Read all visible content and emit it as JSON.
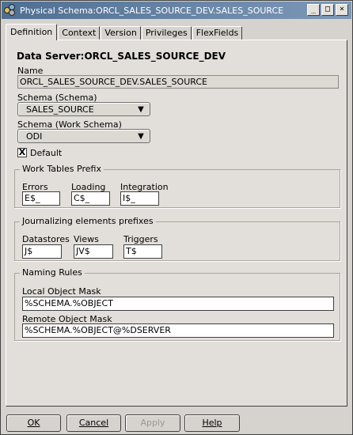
{
  "window": {
    "title": "Physical Schema:ORCL_SALES_SOURCE_DEV.SALES_SOURCE",
    "min_glyph": "_",
    "max_glyph": "□",
    "close_glyph": "×"
  },
  "tabs": [
    {
      "label": "Definition",
      "active": true
    },
    {
      "label": "Context"
    },
    {
      "label": "Version"
    },
    {
      "label": "Privileges"
    },
    {
      "label": "FlexFields"
    }
  ],
  "definition": {
    "data_server_title": "Data Server:ORCL_SALES_SOURCE_DEV",
    "name_label": "Name",
    "name_value": "ORCL_SALES_SOURCE_DEV.SALES_SOURCE",
    "schema_label": "Schema (Schema)",
    "schema_value": "SALES_SOURCE",
    "work_schema_label": "Schema (Work Schema)",
    "work_schema_value": "ODI",
    "default_label": "Default",
    "default_checked": true,
    "default_mark": "X",
    "dropdown_arrow": "▼"
  },
  "work_tables_prefix": {
    "legend": "Work Tables Prefix",
    "errors_label": "Errors",
    "errors_value": "E$_",
    "loading_label": "Loading",
    "loading_value": "C$_",
    "integration_label": "Integration",
    "integration_value": "I$_"
  },
  "journalizing": {
    "legend": "Journalizing elements prefixes",
    "datastores_label": "Datastores",
    "datastores_value": "J$",
    "views_label": "Views",
    "views_value": "JV$",
    "triggers_label": "Triggers",
    "triggers_value": "T$"
  },
  "naming_rules": {
    "legend": "Naming Rules",
    "local_label": "Local Object Mask",
    "local_value": "%SCHEMA.%OBJECT",
    "remote_label": "Remote Object Mask",
    "remote_value": "%SCHEMA.%OBJECT@%DSERVER"
  },
  "buttons": {
    "ok": "OK",
    "cancel": "Cancel",
    "apply": "Apply",
    "help": "Help"
  }
}
